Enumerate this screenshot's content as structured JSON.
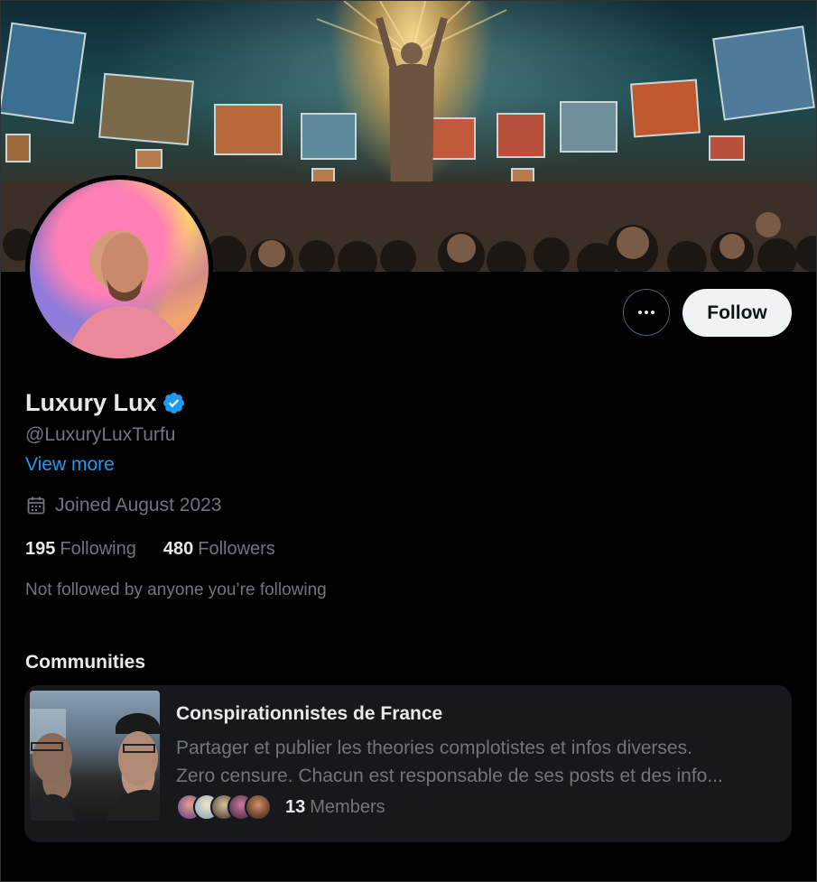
{
  "profile": {
    "display_name": "Luxury Lux",
    "handle": "@LuxuryLuxTurfu",
    "view_more": "View more",
    "joined": "Joined August 2023",
    "following_count": "195",
    "following_label": "Following",
    "followers_count": "480",
    "followers_label": "Followers",
    "not_followed": "Not followed by anyone you’re following",
    "verified": true
  },
  "actions": {
    "follow_label": "Follow",
    "more_icon": "more-horizontal-icon"
  },
  "communities": {
    "title": "Communities",
    "items": [
      {
        "name": "Conspirationnistes de France",
        "description_line1": "Partager et publier les theories complotistes et infos diverses.",
        "description_line2": "Zero censure. Chacun est responsable de ses posts et des info...",
        "member_count": "13",
        "member_label": "Members"
      }
    ]
  },
  "colors": {
    "background": "#000000",
    "text_primary": "#e7e9ea",
    "text_secondary": "#71767b",
    "link": "#1d9bf0",
    "verified": "#1d9bf0",
    "follow_button_bg": "#eff3f4",
    "card_bg": "#16181c"
  }
}
